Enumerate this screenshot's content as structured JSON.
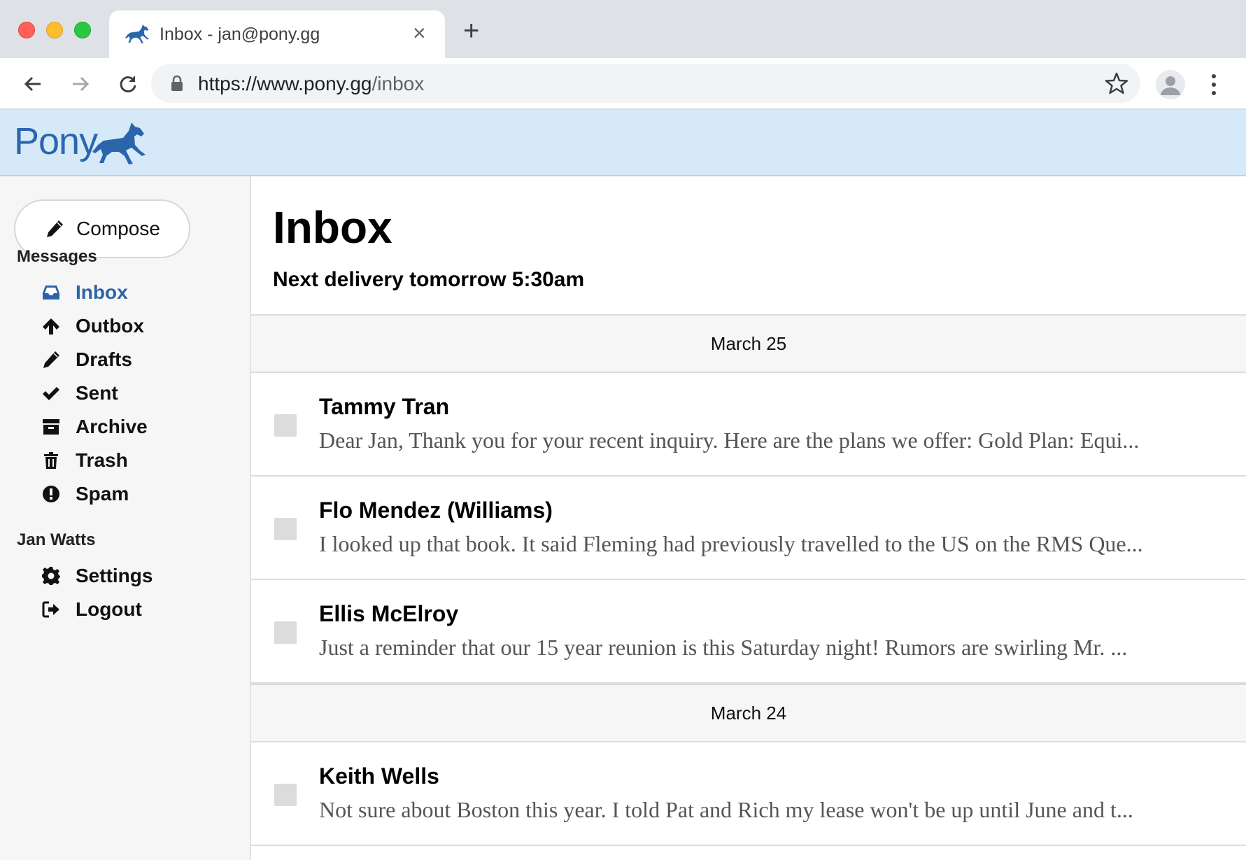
{
  "browser": {
    "tab_title": "Inbox - jan@pony.gg",
    "tab_close": "×",
    "new_tab": "+",
    "url_main": "https://www.pony.gg",
    "url_path": "/inbox"
  },
  "brand": {
    "name": "Pony",
    "color": "#2b66ad"
  },
  "sidebar": {
    "compose_label": "Compose",
    "messages_heading": "Messages",
    "nav": [
      {
        "label": "Inbox",
        "icon": "inbox-icon",
        "active": true
      },
      {
        "label": "Outbox",
        "icon": "arrow-up-icon"
      },
      {
        "label": "Drafts",
        "icon": "pencil-icon"
      },
      {
        "label": "Sent",
        "icon": "check-icon"
      },
      {
        "label": "Archive",
        "icon": "archive-icon"
      },
      {
        "label": "Trash",
        "icon": "trash-icon"
      },
      {
        "label": "Spam",
        "icon": "exclamation-circle-icon"
      }
    ],
    "account_heading": "Jan Watts",
    "account": [
      {
        "label": "Settings",
        "icon": "gear-icon"
      },
      {
        "label": "Logout",
        "icon": "logout-icon"
      }
    ]
  },
  "main": {
    "title": "Inbox",
    "delivery": "Next delivery tomorrow 5:30am",
    "groups": [
      {
        "date": "March 25",
        "messages": [
          {
            "sender": "Tammy Tran",
            "snippet": "Dear Jan, Thank you for your recent inquiry. Here are the plans we offer: Gold Plan: Equi..."
          },
          {
            "sender": "Flo Mendez (Williams)",
            "snippet": "I looked up that book. It said Fleming had previously travelled to the US on the RMS Que..."
          },
          {
            "sender": "Ellis McElroy",
            "snippet": "Just a reminder that our 15 year reunion is this Saturday night! Rumors are swirling Mr. ..."
          }
        ]
      },
      {
        "date": "March 24",
        "messages": [
          {
            "sender": "Keith Wells",
            "snippet": "Not sure about Boston this year. I told Pat and Rich my lease won't be up until June and t..."
          }
        ]
      }
    ]
  },
  "colors": {
    "header_bg": "#d6e9f8",
    "accent": "#2a64a8",
    "sidebar_bg": "#f6f6f6"
  }
}
